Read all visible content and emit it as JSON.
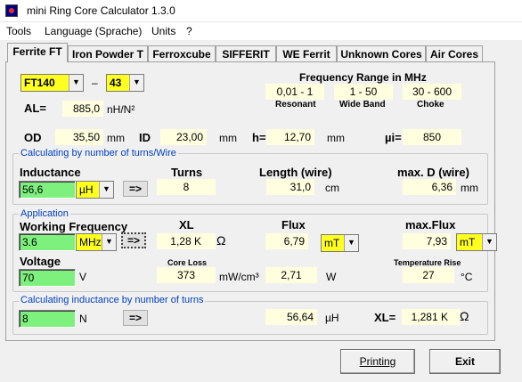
{
  "window": {
    "title": "mini Ring Core Calculator 1.3.0"
  },
  "menu": [
    {
      "label": "Tools"
    },
    {
      "label": "Language (Sprache)"
    },
    {
      "label": "Units"
    },
    {
      "label": "?"
    }
  ],
  "tabs": [
    {
      "label": "Ferrite FT"
    },
    {
      "label": "Iron Powder T"
    },
    {
      "label": "Ferroxcube"
    },
    {
      "label": "SIFFERIT"
    },
    {
      "label": "WE Ferrit"
    },
    {
      "label": "Unknown Cores"
    },
    {
      "label": "Air Cores"
    }
  ],
  "core": {
    "type": "FT140",
    "dash": "–",
    "material": "43",
    "al_label": "AL=",
    "al_value": "885,0",
    "al_unit": "nH/N²",
    "od_label": "OD",
    "od_value": "35,50",
    "od_unit": "mm",
    "id_label": "ID",
    "id_value": "23,00",
    "id_unit": "mm",
    "h_label": "h=",
    "h_value": "12,70",
    "h_unit": "mm",
    "mu_label": "µi=",
    "mu_value": "850"
  },
  "frequency_range": {
    "title": "Frequency Range in MHz",
    "values": [
      "0,01 - 1",
      "1 - 50",
      "30 - 600"
    ],
    "labels": [
      "Resonant",
      "Wide Band",
      "Choke"
    ]
  },
  "turns_section": {
    "title": "Calculating by number of turns/Wire",
    "inductance_label": "Inductance",
    "inductance_value": "56,6",
    "inductance_unit": "µH",
    "arrow": "=>",
    "turns_label": "Turns",
    "turns_value": "8",
    "length_label": "Length (wire)",
    "length_value": "31,0",
    "length_unit": "cm",
    "maxd_label": "max. D (wire)",
    "maxd_value": "6,36",
    "maxd_unit": "mm"
  },
  "application": {
    "title": "Application",
    "freq_label": "Working Frequency",
    "freq_value": "3.6",
    "freq_unit": "MHz",
    "arrow": "=>",
    "xl_label": "XL",
    "xl_value": "1,28 K",
    "flux_label": "Flux",
    "flux_value": "6,79",
    "flux_unit": "mT",
    "maxflux_label": "max.Flux",
    "maxflux_value": "7,93",
    "maxflux_unit": "mT",
    "voltage_label": "Voltage",
    "voltage_value": "70",
    "voltage_unit": "V",
    "coreloss_label": "Core Loss",
    "coreloss_value": "373",
    "coreloss_unit": "mW/cm³",
    "power_value": "2,71",
    "power_unit": "W",
    "temp_label": "Temperature Rise",
    "temp_value": "27",
    "temp_unit": "°C",
    "omega": "Ω"
  },
  "inductance_section": {
    "title": "Calculating inductance by number of turns",
    "turns_value": "8",
    "turns_unit": "N",
    "arrow": "=>",
    "result_value": "56,64",
    "result_unit": "µH",
    "xl_label": "XL=",
    "xl_value": "1,281 K",
    "omega": "Ω"
  },
  "buttons": {
    "printing": "Printing",
    "exit": "Exit"
  }
}
